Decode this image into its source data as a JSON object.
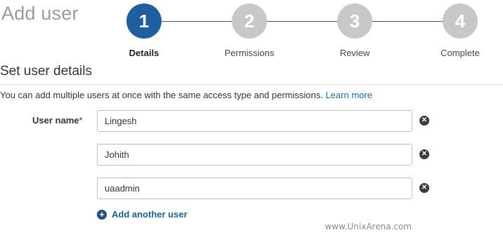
{
  "page": {
    "title": "Add user"
  },
  "stepper": {
    "steps": [
      {
        "number": "1",
        "label": "Details",
        "state": "active"
      },
      {
        "number": "2",
        "label": "Permissions",
        "state": "inactive"
      },
      {
        "number": "3",
        "label": "Review",
        "state": "inactive"
      },
      {
        "number": "4",
        "label": "Complete",
        "state": "inactive"
      }
    ],
    "colors": {
      "active": "#1f5f9f",
      "inactive": "#c8c8c8"
    }
  },
  "details": {
    "section_title": "Set user details",
    "intro_text": "You can add multiple users at once with the same access type and permissions.",
    "learn_more": "Learn more",
    "user_name_label": "User name",
    "required_mark": "*",
    "users": [
      {
        "value": "Lingesh"
      },
      {
        "value": "Johith"
      },
      {
        "value": "uaadmin"
      }
    ],
    "add_another": "Add another user",
    "icons": {
      "remove": "remove-circle-icon",
      "add": "plus-circle-icon"
    }
  },
  "watermark": "www.UnixArena.com"
}
